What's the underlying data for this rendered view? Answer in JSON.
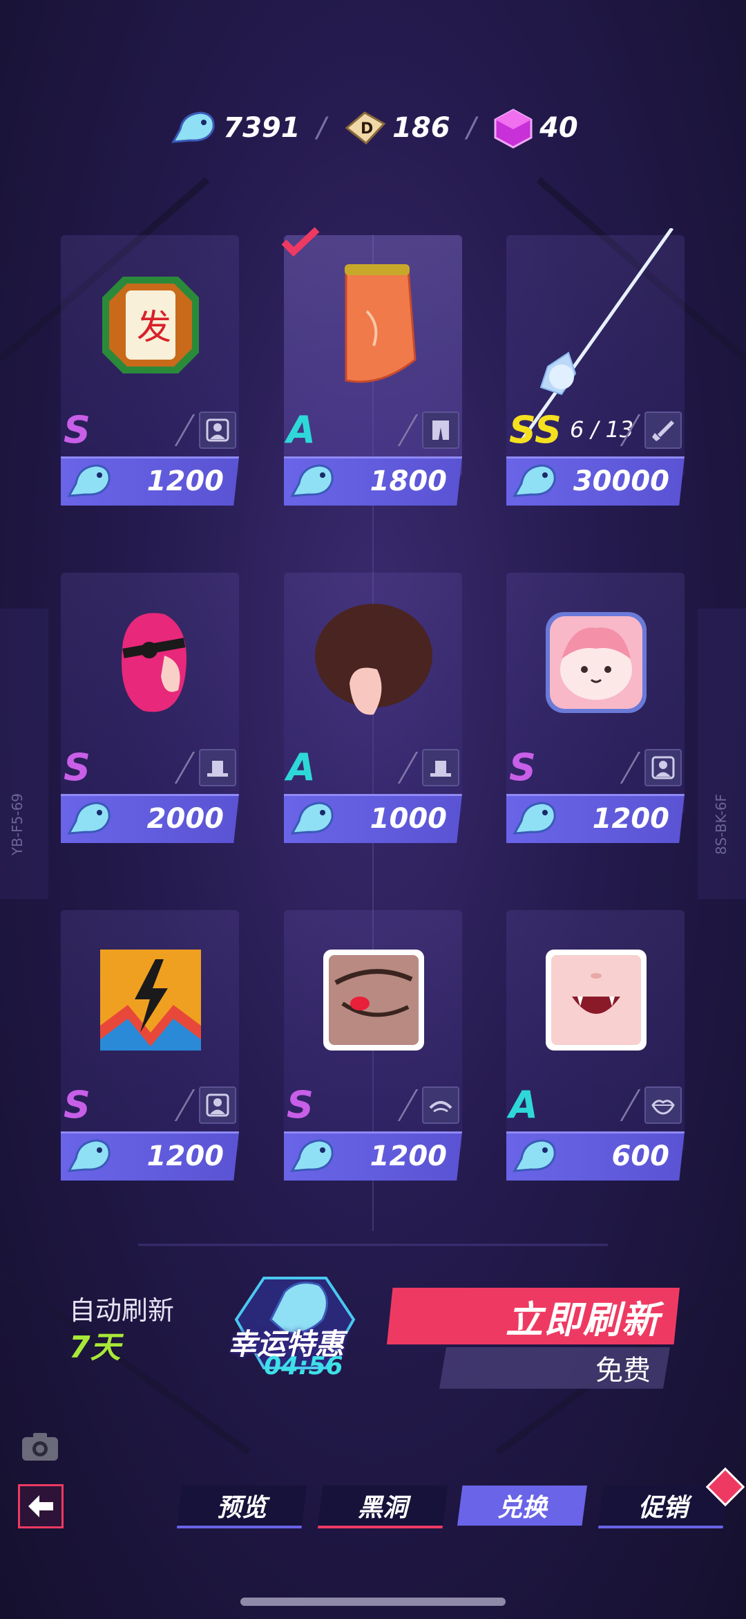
{
  "currencies": [
    {
      "icon": "fish-currency-icon",
      "value": "7391"
    },
    {
      "icon": "dice-ticket-icon",
      "value": "186"
    },
    {
      "icon": "purple-cube-icon",
      "value": "40"
    }
  ],
  "separator": "/",
  "side_codes": {
    "left": "YB-F5-69",
    "right": "8S-BK-6F"
  },
  "items": [
    {
      "name": "mahjong-tile-avatar",
      "rarity": "S",
      "type_icon": "avatar-frame-icon",
      "price": "1200"
    },
    {
      "name": "orange-skirt",
      "rarity": "A",
      "type_icon": "pants-icon",
      "price": "1800",
      "selected": true
    },
    {
      "name": "ice-spear-weapon",
      "rarity": "SS",
      "type_icon": "weapon-icon",
      "price": "30000",
      "progress": "6 / 13"
    },
    {
      "name": "pink-pirate-hair",
      "rarity": "S",
      "type_icon": "hat-icon",
      "price": "2000"
    },
    {
      "name": "afro-hair",
      "rarity": "A",
      "type_icon": "hat-icon",
      "price": "1000"
    },
    {
      "name": "pink-character-avatar",
      "rarity": "S",
      "type_icon": "avatar-frame-icon",
      "price": "1200"
    },
    {
      "name": "lightning-avatar",
      "rarity": "S",
      "type_icon": "avatar-frame-icon",
      "price": "1200"
    },
    {
      "name": "red-eye",
      "rarity": "S",
      "type_icon": "eye-icon",
      "price": "1200"
    },
    {
      "name": "fang-mouth",
      "rarity": "A",
      "type_icon": "lips-icon",
      "price": "600"
    }
  ],
  "refresh": {
    "auto_label": "自动刷新",
    "auto_days": "7天",
    "lucky_title": "幸运特惠",
    "lucky_timer": "04:56",
    "refresh_button": "立即刷新",
    "free_label": "免费"
  },
  "tabs": [
    "预览",
    "黑洞",
    "兑换",
    "促销"
  ],
  "active_tab": "兑换",
  "colors": {
    "accent_pink": "#ee3a62",
    "accent_blue": "#6a64e8",
    "rarity_S": "#c85fe8",
    "rarity_A": "#2fd8d8",
    "rarity_SS": "#f5e020",
    "days_green": "#a8e838"
  }
}
